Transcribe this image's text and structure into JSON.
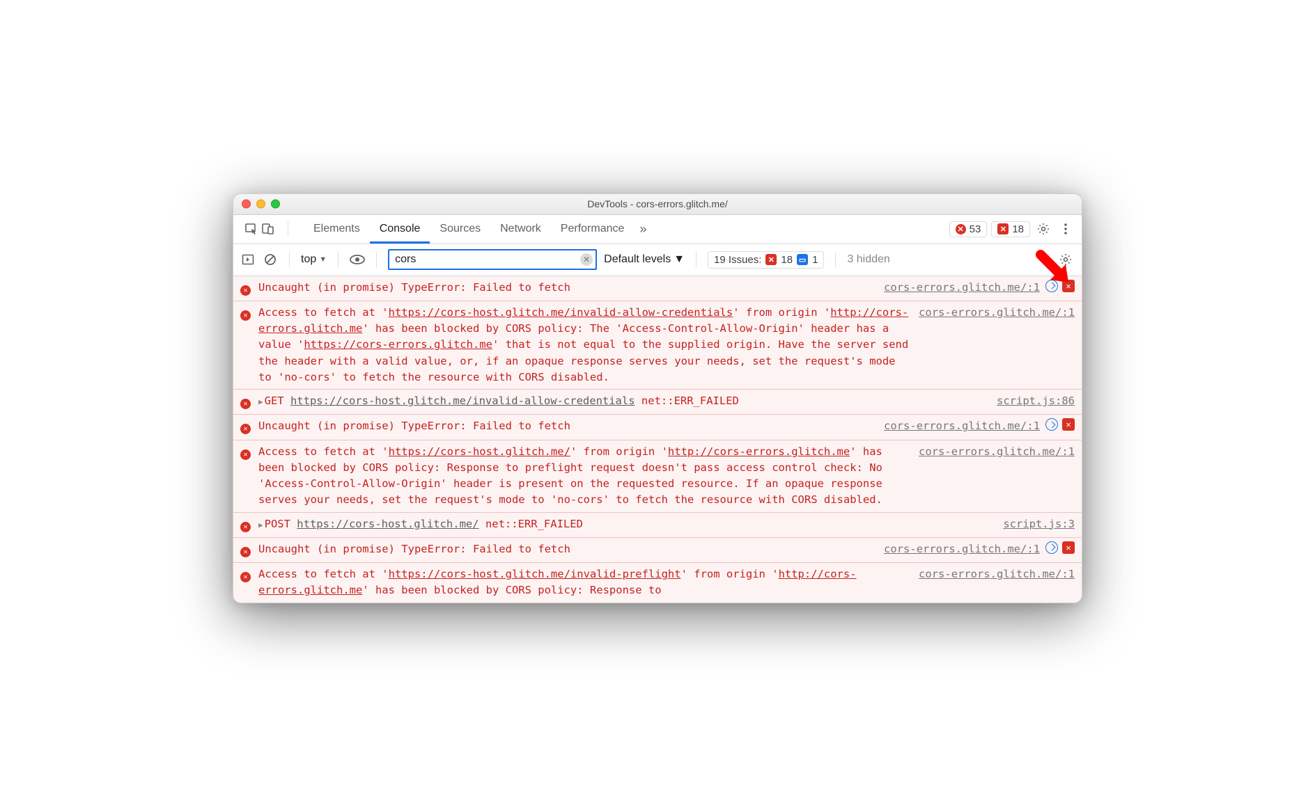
{
  "window": {
    "title": "DevTools - cors-errors.glitch.me/"
  },
  "tabs": {
    "items": [
      "Elements",
      "Console",
      "Sources",
      "Network",
      "Performance"
    ],
    "active": 1
  },
  "tabstrip_badges": {
    "errors": "53",
    "issues": "18"
  },
  "filterbar": {
    "context": "top",
    "filter_value": "cors",
    "levels": "Default levels",
    "issues_label": "19 Issues:",
    "issues_err": "18",
    "issues_info": "1",
    "hidden": "3 hidden"
  },
  "rows": [
    {
      "type": "uncaught",
      "msg": "Uncaught (in promise) TypeError: Failed to fetch",
      "src": "cors-errors.glitch.me/:1",
      "actions": true
    },
    {
      "type": "cors",
      "src": "cors-errors.glitch.me/:1",
      "parts": {
        "pre": "Access to fetch at '",
        "url1": "https://cors-host.glitch.me/invalid-allow-credentials",
        "mid1": "' from origin '",
        "url2": "http://cors-errors.glitch.me",
        "mid2": "' has been blocked by CORS policy: The 'Access-Control-Allow-Origin' header has a value '",
        "url3": "https://cors-errors.glitch.me",
        "post": "' that is not equal to the supplied origin. Have the server send the header with a valid value, or, if an opaque response serves your needs, set the request's mode to 'no-cors' to fetch the resource with CORS disabled."
      }
    },
    {
      "type": "net",
      "method": "GET",
      "url": "https://cors-host.glitch.me/invalid-allow-credentials",
      "err": "net::ERR_FAILED",
      "src": "script.js:86"
    },
    {
      "type": "uncaught",
      "msg": "Uncaught (in promise) TypeError: Failed to fetch",
      "src": "cors-errors.glitch.me/:1",
      "actions": true
    },
    {
      "type": "cors",
      "src": "cors-errors.glitch.me/:1",
      "parts": {
        "pre": "Access to fetch at '",
        "url1": "https://cors-host.glitch.me/",
        "mid1": "' from origin '",
        "url2": "http://cors-errors.glitch.me",
        "post": "' has been blocked by CORS policy: Response to preflight request doesn't pass access control check: No 'Access-Control-Allow-Origin' header is present on the requested resource. If an opaque response serves your needs, set the request's mode to 'no-cors' to fetch the resource with CORS disabled."
      }
    },
    {
      "type": "net",
      "method": "POST",
      "url": "https://cors-host.glitch.me/",
      "err": "net::ERR_FAILED",
      "src": "script.js:3"
    },
    {
      "type": "uncaught",
      "msg": "Uncaught (in promise) TypeError: Failed to fetch",
      "src": "cors-errors.glitch.me/:1",
      "actions": true
    },
    {
      "type": "cors",
      "src": "cors-errors.glitch.me/:1",
      "parts": {
        "pre": "Access to fetch at '",
        "url1": "https://cors-host.glitch.me/invalid-preflight",
        "mid1": "' from origin '",
        "url2": "http://cors-errors.glitch.me",
        "post": "' has been blocked by CORS policy: Response to"
      }
    }
  ]
}
